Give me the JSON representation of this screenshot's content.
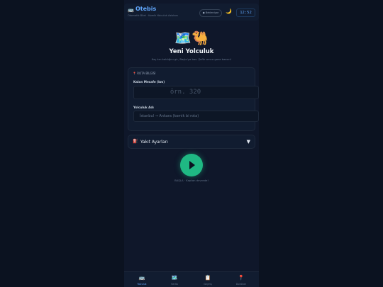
{
  "header": {
    "icon": "bus-icon",
    "title": "Otebis",
    "subtitle": "Otomatik Bilet · Komik Yolculuk Asistanı",
    "status": "● Bekleniyor",
    "theme_icon": "🌙",
    "clock": "12:52"
  },
  "hero": {
    "icons": "🗺️🐫",
    "title": "Yeni Yolculuk",
    "subtitle": "Kaç km kaldığını gir, Başla'ya bas. Şoför amca gaza bassın!"
  },
  "trip_card": {
    "section_title": "📍 ROTA BİLGİSİ",
    "distance_label": "Kalan Mesafe (km)",
    "distance_placeholder": "örn. 320",
    "name_label": "Yolculuk Adı",
    "name_placeholder": "İstanbul → Ankara (komik bi rota)"
  },
  "fuel": {
    "icon": "⛽",
    "label": "Yakıt Ayarları",
    "chevron": "▼"
  },
  "start": {
    "caption": "BAŞLA · Kaptan devrede!"
  },
  "nav": {
    "items": [
      {
        "icon": "🚌",
        "label": "Yolculuk"
      },
      {
        "icon": "🗺️",
        "label": "Harita"
      },
      {
        "icon": "📋",
        "label": "Geçmiş"
      },
      {
        "icon": "📍",
        "label": "Durakları"
      }
    ]
  },
  "colors": {
    "background": "#0b1220",
    "accent": "#60a5fa",
    "start_button": "#1fb883"
  }
}
